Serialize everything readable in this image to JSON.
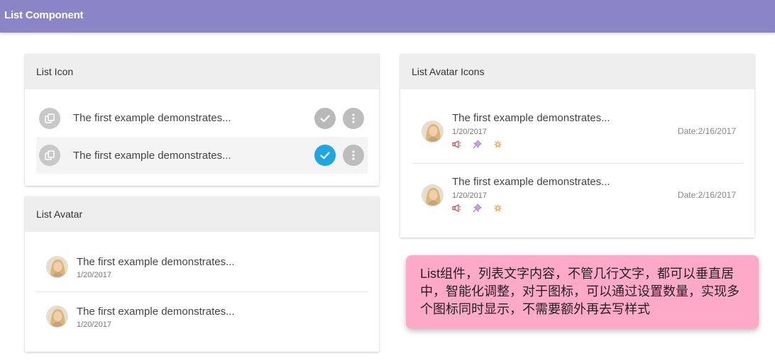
{
  "appbar": {
    "title": "List Component"
  },
  "list_icon_card": {
    "header": "List Icon",
    "items": [
      {
        "text": "The first example demonstrates...",
        "checked": false
      },
      {
        "text": "The first example demonstrates...",
        "checked": true
      }
    ]
  },
  "list_avatar_card": {
    "header": "List Avatar",
    "items": [
      {
        "text": "The first example demonstrates...",
        "date": "1/20/2017"
      },
      {
        "text": "The first example demonstrates...",
        "date": "1/20/2017"
      }
    ]
  },
  "list_avatar_icons_card": {
    "header": "List Avatar Icons",
    "items": [
      {
        "text": "The first example demonstrates...",
        "date": "1/20/2017",
        "right_date": "Date:2/16/2017",
        "icons": [
          "megaphone-icon",
          "pin-icon",
          "burst-icon"
        ]
      },
      {
        "text": "The first example demonstrates...",
        "date": "1/20/2017",
        "right_date": "Date:2/16/2017",
        "icons": [
          "megaphone-icon",
          "pin-icon",
          "burst-icon"
        ]
      }
    ]
  },
  "note": {
    "text": "List组件，列表文字内容，不管几行文字，都可以垂直居中，智能化调整，对于图标，可以通过设置数量，实现多个图标同时显示，不需要额外再去写样式"
  },
  "colors": {
    "appbar": "#8b84c7",
    "check_active": "#1ea5e2",
    "note_bg": "#ffa9c8"
  }
}
